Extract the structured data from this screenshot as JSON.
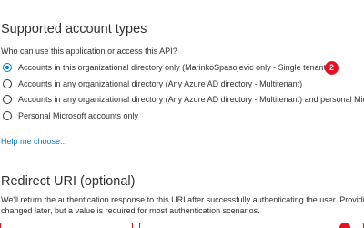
{
  "account_types": {
    "title": "Supported account types",
    "question": "Who can use this application or access this API?",
    "options": [
      {
        "label": "Accounts in this organizational directory only (MarinkoSpasojevic only - Single tenant)",
        "selected": true
      },
      {
        "label": "Accounts in any organizational directory (Any Azure AD directory - Multitenant)",
        "selected": false
      },
      {
        "label": "Accounts in any organizational directory (Any Azure AD directory - Multitenant) and personal Mic",
        "selected": false
      },
      {
        "label": "Personal Microsoft accounts only",
        "selected": false
      }
    ],
    "badge": "2",
    "help_link": "Help me choose..."
  },
  "redirect_uri": {
    "title": "Redirect URI (optional)",
    "description_line1": "We'll return the authentication response to this URI after successfully authenticating the user. Providin",
    "description_line2": "changed later, but a value is required for most authentication scenarios.",
    "platform_value": "",
    "uri_value": "",
    "uri_placeholder": ""
  },
  "colors": {
    "accent": "#0078d4",
    "badge": "#e81123",
    "text": "#323130"
  }
}
